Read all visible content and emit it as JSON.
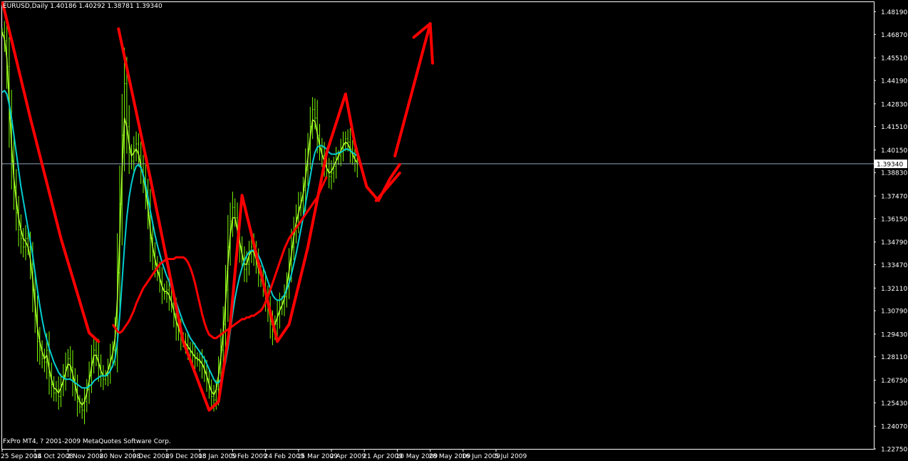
{
  "window": {
    "symbol_line": "EURUSD,Daily  1.40186 1.40292 1.38781 1.39340",
    "copyright": "FxPro MT4, ? 2001-2009 MetaQuotes Software Corp."
  },
  "colors": {
    "background": "#000000",
    "frame": "#ffffff",
    "candles": "#7cfc00",
    "fast_ma": "#adff2f",
    "slow_ma": "#00ced1",
    "long_ma": "#ff0000",
    "drawing": "#ff0000",
    "bid_line": "#8fa6b8"
  },
  "chart_data": {
    "type": "line",
    "symbol": "EURUSD",
    "timeframe": "Daily",
    "last_quote": {
      "open": 1.40186,
      "high": 1.40292,
      "low": 1.38781,
      "close": 1.3934
    },
    "current_price_label": "1.39340",
    "ylim": [
      1.2275,
      1.4875
    ],
    "y_ticks": [
      "1.48190",
      "1.46870",
      "1.45510",
      "1.44190",
      "1.42830",
      "1.41510",
      "1.40150",
      "1.38830",
      "1.37470",
      "1.36150",
      "1.34790",
      "1.33470",
      "1.32110",
      "1.30790",
      "1.29430",
      "1.28110",
      "1.26750",
      "1.25430",
      "1.24070",
      "1.22750"
    ],
    "x_ticks": [
      "25 Sep 2008",
      "14 Oct 2008",
      "2 Nov 2008",
      "20 Nov 2008",
      "9 Dec 2008",
      "29 Dec 2008",
      "18 Jan 2009",
      "5 Feb 2009",
      "24 Feb 2009",
      "15 Mar 2009",
      "2 Apr 2009",
      "21 Apr 2009",
      "10 May 2009",
      "28 May 2009",
      "16 Jun 2009",
      "5 Jul 2009"
    ],
    "bars_between_ticks": 14,
    "grid": false,
    "series": [
      {
        "key": "price",
        "style": "bars",
        "values": [
          1.47,
          1.465,
          1.45,
          1.42,
          1.395,
          1.38,
          1.365,
          1.355,
          1.35,
          1.345,
          1.35,
          1.345,
          1.335,
          1.32,
          1.305,
          1.29,
          1.285,
          1.28,
          1.278,
          1.285,
          1.27,
          1.265,
          1.26,
          1.262,
          1.258,
          1.265,
          1.27,
          1.275,
          1.28,
          1.275,
          1.268,
          1.262,
          1.255,
          1.252,
          1.25,
          1.255,
          1.262,
          1.27,
          1.278,
          1.285,
          1.282,
          1.276,
          1.27,
          1.268,
          1.27,
          1.274,
          1.28,
          1.285,
          1.295,
          1.33,
          1.37,
          1.41,
          1.44,
          1.415,
          1.4,
          1.395,
          1.402,
          1.405,
          1.398,
          1.39,
          1.385,
          1.375,
          1.365,
          1.35,
          1.34,
          1.335,
          1.33,
          1.325,
          1.32,
          1.318,
          1.32,
          1.316,
          1.312,
          1.306,
          1.3,
          1.296,
          1.292,
          1.29,
          1.288,
          1.286,
          1.284,
          1.282,
          1.28,
          1.279,
          1.278,
          1.276,
          1.272,
          1.268,
          1.262,
          1.258,
          1.256,
          1.262,
          1.272,
          1.285,
          1.3,
          1.32,
          1.345,
          1.36,
          1.368,
          1.362,
          1.352,
          1.345,
          1.338,
          1.332,
          1.335,
          1.342,
          1.345,
          1.342,
          1.336,
          1.33,
          1.326,
          1.322,
          1.316,
          1.308,
          1.3,
          1.296,
          1.3,
          1.306,
          1.31,
          1.312,
          1.316,
          1.324,
          1.335,
          1.345,
          1.355,
          1.362,
          1.368,
          1.372,
          1.378,
          1.39,
          1.402,
          1.415,
          1.425,
          1.42,
          1.41,
          1.402,
          1.398,
          1.394,
          1.39,
          1.386,
          1.388,
          1.392,
          1.396,
          1.398,
          1.402,
          1.405,
          1.408,
          1.406,
          1.402,
          1.398,
          1.395,
          1.393
        ]
      },
      {
        "key": "fast_ma",
        "style": "line",
        "values": [
          1.47,
          1.466,
          1.455,
          1.43,
          1.405,
          1.385,
          1.372,
          1.362,
          1.355,
          1.35,
          1.348,
          1.345,
          1.338,
          1.326,
          1.312,
          1.298,
          1.29,
          1.284,
          1.28,
          1.282,
          1.274,
          1.268,
          1.263,
          1.262,
          1.26,
          1.263,
          1.267,
          1.272,
          1.277,
          1.276,
          1.271,
          1.265,
          1.259,
          1.255,
          1.253,
          1.255,
          1.26,
          1.267,
          1.275,
          1.282,
          1.282,
          1.278,
          1.273,
          1.27,
          1.27,
          1.273,
          1.278,
          1.283,
          1.292,
          1.315,
          1.35,
          1.39,
          1.42,
          1.415,
          1.405,
          1.398,
          1.4,
          1.402,
          1.399,
          1.392,
          1.386,
          1.378,
          1.368,
          1.355,
          1.345,
          1.338,
          1.332,
          1.327,
          1.322,
          1.319,
          1.319,
          1.317,
          1.313,
          1.308,
          1.302,
          1.298,
          1.294,
          1.291,
          1.289,
          1.287,
          1.285,
          1.283,
          1.281,
          1.28,
          1.279,
          1.277,
          1.274,
          1.27,
          1.265,
          1.261,
          1.259,
          1.262,
          1.27,
          1.281,
          1.295,
          1.313,
          1.335,
          1.352,
          1.362,
          1.362,
          1.355,
          1.348,
          1.341,
          1.335,
          1.335,
          1.34,
          1.343,
          1.342,
          1.338,
          1.332,
          1.328,
          1.324,
          1.318,
          1.311,
          1.304,
          1.299,
          1.3,
          1.304,
          1.308,
          1.311,
          1.315,
          1.322,
          1.331,
          1.341,
          1.351,
          1.359,
          1.365,
          1.37,
          1.376,
          1.386,
          1.397,
          1.409,
          1.419,
          1.418,
          1.411,
          1.404,
          1.399,
          1.395,
          1.391,
          1.388,
          1.389,
          1.392,
          1.395,
          1.398,
          1.401,
          1.404,
          1.406,
          1.405,
          1.402,
          1.399,
          1.396,
          1.394
        ]
      },
      {
        "key": "slow_ma",
        "style": "line",
        "values": [
          1.435,
          1.436,
          1.434,
          1.428,
          1.42,
          1.41,
          1.4,
          1.39,
          1.38,
          1.372,
          1.364,
          1.356,
          1.348,
          1.34,
          1.33,
          1.32,
          1.311,
          1.303,
          1.296,
          1.291,
          1.286,
          1.282,
          1.278,
          1.275,
          1.272,
          1.27,
          1.269,
          1.268,
          1.268,
          1.268,
          1.267,
          1.266,
          1.265,
          1.264,
          1.263,
          1.263,
          1.263,
          1.264,
          1.265,
          1.267,
          1.268,
          1.269,
          1.27,
          1.27,
          1.27,
          1.271,
          1.273,
          1.276,
          1.28,
          1.29,
          1.305,
          1.325,
          1.345,
          1.362,
          1.374,
          1.382,
          1.388,
          1.392,
          1.393,
          1.391,
          1.387,
          1.381,
          1.374,
          1.366,
          1.359,
          1.352,
          1.346,
          1.341,
          1.336,
          1.332,
          1.328,
          1.325,
          1.321,
          1.317,
          1.313,
          1.309,
          1.305,
          1.301,
          1.298,
          1.295,
          1.292,
          1.29,
          1.288,
          1.286,
          1.284,
          1.282,
          1.28,
          1.277,
          1.274,
          1.271,
          1.268,
          1.266,
          1.266,
          1.268,
          1.272,
          1.278,
          1.286,
          1.296,
          1.306,
          1.315,
          1.322,
          1.328,
          1.333,
          1.337,
          1.34,
          1.342,
          1.343,
          1.343,
          1.342,
          1.34,
          1.337,
          1.333,
          1.329,
          1.325,
          1.321,
          1.317,
          1.315,
          1.314,
          1.314,
          1.315,
          1.317,
          1.32,
          1.324,
          1.329,
          1.335,
          1.341,
          1.348,
          1.355,
          1.362,
          1.37,
          1.378,
          1.386,
          1.394,
          1.4,
          1.403,
          1.404,
          1.404,
          1.403,
          1.402,
          1.4,
          1.399,
          1.399,
          1.399,
          1.4,
          1.4,
          1.401,
          1.402,
          1.402,
          1.401,
          1.4,
          1.399,
          1.398
        ]
      },
      {
        "key": "long_ma",
        "style": "line",
        "values": [
          null,
          null,
          null,
          null,
          null,
          null,
          null,
          null,
          null,
          null,
          null,
          null,
          null,
          null,
          null,
          null,
          null,
          null,
          null,
          null,
          null,
          null,
          null,
          null,
          null,
          null,
          null,
          null,
          null,
          null,
          null,
          null,
          null,
          null,
          null,
          null,
          null,
          null,
          null,
          null,
          null,
          null,
          null,
          null,
          null,
          null,
          null,
          1.3,
          1.298,
          1.296,
          1.295,
          1.296,
          1.298,
          1.3,
          1.302,
          1.305,
          1.308,
          1.312,
          1.315,
          1.318,
          1.321,
          1.323,
          1.325,
          1.327,
          1.329,
          1.331,
          1.333,
          1.335,
          1.336,
          1.337,
          1.338,
          1.338,
          1.338,
          1.338,
          1.339,
          1.339,
          1.339,
          1.339,
          1.338,
          1.336,
          1.333,
          1.329,
          1.324,
          1.318,
          1.312,
          1.306,
          1.301,
          1.297,
          1.294,
          1.293,
          1.292,
          1.292,
          1.293,
          1.294,
          1.295,
          1.296,
          1.297,
          1.298,
          1.299,
          1.3,
          1.301,
          1.302,
          1.303,
          1.303,
          1.304,
          1.304,
          1.305,
          1.305,
          1.306,
          1.307,
          1.308,
          1.31,
          1.313,
          1.316,
          1.32,
          1.324,
          1.328,
          1.332,
          1.336,
          1.34,
          1.344,
          1.347,
          1.35,
          1.352,
          1.354,
          1.356,
          1.358,
          1.36,
          1.362,
          1.364,
          1.366,
          1.368,
          1.37,
          1.372,
          1.374,
          1.377,
          1.38,
          1.383,
          1.386,
          null,
          null,
          null,
          null,
          null,
          null,
          null,
          null,
          null,
          null,
          null,
          null,
          null,
          null,
          null,
          null,
          null,
          null,
          null,
          null
        ]
      }
    ],
    "annotations": [
      {
        "type": "polyline",
        "points": [
          [
            0.2,
            1.487
          ],
          [
            12,
            1.42
          ],
          [
            25,
            1.35
          ],
          [
            37,
            1.295
          ],
          [
            41,
            1.29
          ]
        ]
      },
      {
        "type": "polyline",
        "points": [
          [
            49.5,
            1.472
          ],
          [
            63,
            1.385
          ],
          [
            77,
            1.29
          ],
          [
            88,
            1.25
          ],
          [
            92,
            1.255
          ],
          [
            97,
            1.3
          ],
          [
            102,
            1.375
          ]
        ]
      },
      {
        "type": "polyline",
        "points": [
          [
            102,
            1.375
          ],
          [
            110,
            1.33
          ],
          [
            117,
            1.29
          ],
          [
            122,
            1.3
          ],
          [
            130,
            1.345
          ],
          [
            138,
            1.4
          ],
          [
            146,
            1.434
          ]
        ]
      },
      {
        "type": "polyline",
        "points": [
          [
            146,
            1.434
          ],
          [
            150,
            1.405
          ],
          [
            155,
            1.38
          ],
          [
            160,
            1.372
          ],
          [
            165,
            1.385
          ],
          [
            169,
            1.393
          ]
        ]
      },
      {
        "type": "line",
        "points": [
          [
            159,
            1.372
          ],
          [
            169,
            1.388
          ]
        ]
      },
      {
        "type": "line",
        "points": [
          [
            167,
            1.398
          ],
          [
            182,
            1.475
          ]
        ]
      },
      {
        "type": "polyline",
        "points": [
          [
            175,
            1.467
          ],
          [
            182,
            1.475
          ],
          [
            183,
            1.452
          ]
        ]
      }
    ]
  }
}
